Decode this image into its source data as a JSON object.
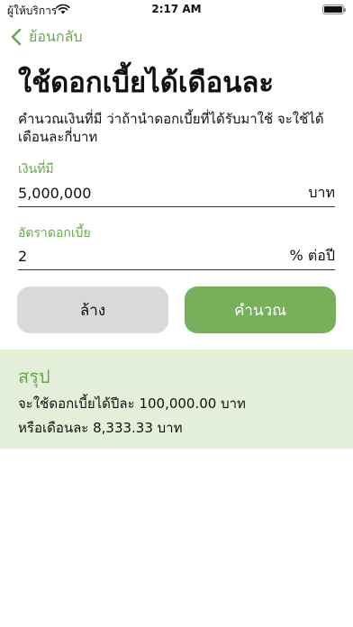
{
  "status_bar": {
    "carrier": "ผู้ให้บริการ",
    "time": "2:17 AM",
    "icons": [
      "wifi-icon",
      "battery-icon"
    ]
  },
  "nav": {
    "back_label": "ย้อนกลับ",
    "back_icon": "chevron-left-icon"
  },
  "page": {
    "title": "ใช้ดอกเบี้ยได้เดือนละ",
    "description": "คำนวณเงินที่มี ว่าถ้านำดอกเบี้ยที่ได้รับมาใช้ จะใช้ได้เดือนละกี่บาท"
  },
  "form": {
    "amount": {
      "label": "เงินที่มี",
      "value": "5,000,000",
      "unit": "บาท"
    },
    "rate": {
      "label": "อัตราดอกเบี้ย",
      "value": "2",
      "unit": "% ต่อปี"
    }
  },
  "buttons": {
    "clear_label": "ล้าง",
    "calculate_label": "คำนวณ"
  },
  "summary": {
    "title": "สรุป",
    "yearly_line": "จะใช้ดอกเบี้ยได้ปีละ 100,000.00 บาท",
    "monthly_line": "หรือเดือนละ 8,333.33 บาท"
  },
  "colors": {
    "accent": "#6aa84f",
    "button_primary": "#77b05a",
    "button_secondary": "#d9d9d9",
    "summary_bg": "#e3efd9"
  }
}
